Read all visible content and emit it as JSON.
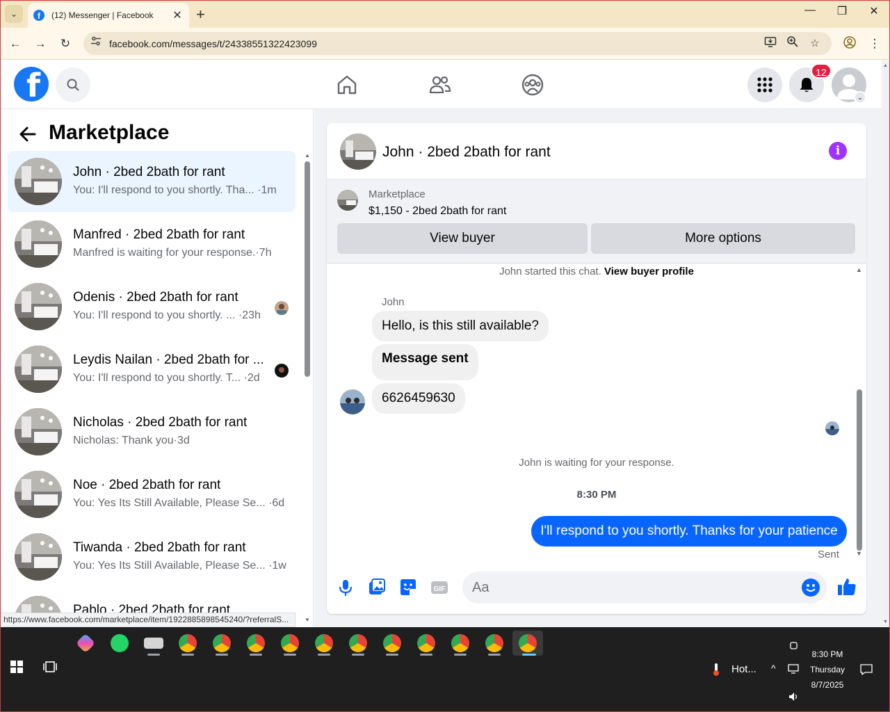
{
  "browser": {
    "tab_title": "(12) Messenger | Facebook",
    "url": "facebook.com/messages/t/24338551322423099",
    "status_url": "https://www.facebook.com/marketplace/item/1922885898545240/?referralS..."
  },
  "header": {
    "notification_count": "12"
  },
  "left": {
    "title": "Marketplace",
    "conversations": [
      {
        "name": "John · 2bed 2bath for rant",
        "preview": "You: I'll respond to you shortly. Tha... ·1m"
      },
      {
        "name": "Manfred · 2bed 2bath for rant",
        "preview": "Manfred is waiting for your response.·7h"
      },
      {
        "name": "Odenis · 2bed 2bath for rant",
        "preview": "You: I'll respond to you shortly. ... ·23h"
      },
      {
        "name": "Leydis Nailan · 2bed 2bath for ...",
        "preview": "You: I'll respond to you shortly. T... ·2d"
      },
      {
        "name": "Nicholas · 2bed 2bath for rant",
        "preview": "Nicholas: Thank you·3d"
      },
      {
        "name": "Noe · 2bed 2bath for rant",
        "preview": "You: Yes Its Still Available, Please Se... ·6d"
      },
      {
        "name": "Tiwanda · 2bed 2bath for rant",
        "preview": "You: Yes Its Still Available, Please Se... ·1w"
      },
      {
        "name": "Pablo · 2bed 2bath for rant",
        "preview": ""
      }
    ]
  },
  "chat": {
    "title": "John · 2bed 2bath for rant",
    "marketplace_label": "Marketplace",
    "listing": "$1,150 - 2bed 2bath for rant",
    "view_buyer": "View buyer",
    "more_options": "More options",
    "started_prefix": "John started this chat.",
    "view_buyer_profile": "View buyer profile",
    "sender": "John",
    "messages_in": [
      "Hello, is this still available?",
      "Message sent",
      "6626459630"
    ],
    "waiting": "John is waiting for your response.",
    "time": "8:30 PM",
    "message_out": "I'll respond to you shortly. Thanks for your patience",
    "sent": "Sent",
    "composer_placeholder": "Aa"
  },
  "taskbar": {
    "weather": "Hot...",
    "time": "8:30 PM",
    "day": "Thursday",
    "date": "8/7/2025"
  },
  "colors": {
    "accent": "#1877f2",
    "outgoing_bubble": "#0866ff",
    "badge": "#e41e3f",
    "info": "#a033ff"
  }
}
